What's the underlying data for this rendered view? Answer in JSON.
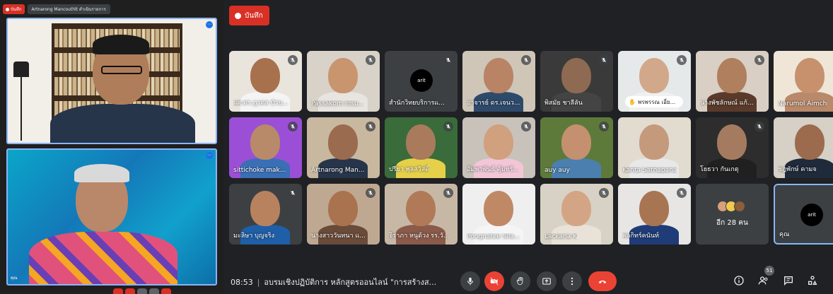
{
  "left_panel": {
    "rec_label": "บันทึก",
    "pinned_name": "Artnarong Mancouthlt ดำเนินรายการ",
    "self_view_label": "คุณ"
  },
  "record_button": {
    "label": "บันทึก"
  },
  "tiles": [
    {
      "name": "ผศ.ดร.ภูวดล บัวบ...",
      "muted": true
    },
    {
      "name": "Passakorn Insu...",
      "muted": true
    },
    {
      "name": "สำนักวิทยบริการแ...",
      "muted": true,
      "logo": "arit"
    },
    {
      "name": "อาจารย์ ดร.เจนว...",
      "muted": true
    },
    {
      "name": "พิสมัย ชาลีลัน",
      "muted": true
    },
    {
      "name": "พรพรรณ เอี่ย...",
      "muted": true,
      "hand_raised": true
    },
    {
      "name": "นางพัชลักษณ์ แก้...",
      "muted": true
    },
    {
      "name": "Narumol Aimch",
      "muted": false
    },
    {
      "name": "sittichoke mak...",
      "muted": true
    },
    {
      "name": "Artnarong Man...",
      "muted": true
    },
    {
      "name": "ปรียา พุลสวัสดิ์",
      "muted": true
    },
    {
      "name": "อัมพาพันธ์ คุ้มทรั...",
      "muted": true
    },
    {
      "name": "auy auy",
      "muted": true
    },
    {
      "name": "Kanta Sathapana",
      "muted": false
    },
    {
      "name": "โยธวา กันเกตุ",
      "muted": true
    },
    {
      "name": "ชฎพักษ์ คามจ",
      "muted": false
    },
    {
      "name": "มะลิษา บุญจริง",
      "muted": true
    },
    {
      "name": "นางสาววันทนา แ...",
      "muted": true
    },
    {
      "name": "จิราภา หนูด้วง รร.วั...",
      "muted": true
    },
    {
      "name": "Pongnatee Sila...",
      "muted": false
    },
    {
      "name": "Lackana K",
      "muted": true
    },
    {
      "name": "พลกิทร์คนันท์",
      "muted": true
    },
    {
      "name": "อีก 28 คน",
      "others": true
    },
    {
      "name": "คุณ",
      "self": true,
      "logo": "arit"
    }
  ],
  "bottom_bar": {
    "time": "08:53",
    "meeting_title": "อบรมเชิงปฏิบัติการ หลักสูตรออนไลน์ \"การสร้างส...",
    "participants_count": "51"
  },
  "icons": {
    "mic": "mic-icon",
    "camera_off": "camera-off-icon",
    "hand": "raise-hand-icon",
    "present": "present-icon",
    "more": "more-options-icon",
    "leave": "leave-call-icon",
    "info": "info-icon",
    "people": "people-icon",
    "chat": "chat-icon",
    "activities": "activities-icon"
  },
  "colors": {
    "accent_red": "#ea4335",
    "record_red": "#d93025",
    "highlight_blue": "#8ab4f8"
  }
}
